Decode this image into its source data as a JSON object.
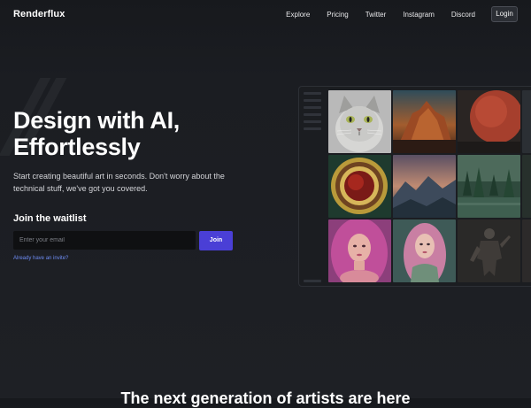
{
  "nav": {
    "logo": "Renderflux",
    "links": [
      "Explore",
      "Pricing",
      "Twitter",
      "Instagram",
      "Discord"
    ],
    "login_label": "Login"
  },
  "hero": {
    "title_line1": "Design with AI,",
    "title_line2": "Effortlessly",
    "subtitle": "Start creating beautiful art in seconds. Don't worry about the technical stuff, we've got you covered."
  },
  "waitlist": {
    "heading": "Join the waitlist",
    "email_placeholder": "Enter your email",
    "join_label": "Join",
    "invite_link": "Already have an invite?"
  },
  "gallery": {
    "images": [
      "grey cat portrait",
      "orange mountain sunset",
      "red planet",
      "red orb in golden ring",
      "mountain valley at dusk",
      "misty forest lake",
      "pink haired woman portrait",
      "pink haired elf portrait",
      "dark armored warrior"
    ]
  },
  "section": {
    "heading": "The next generation of artists are here"
  },
  "colors": {
    "accent": "#4a3fd6",
    "link": "#6d8bf2",
    "background": "#1b1d22"
  }
}
